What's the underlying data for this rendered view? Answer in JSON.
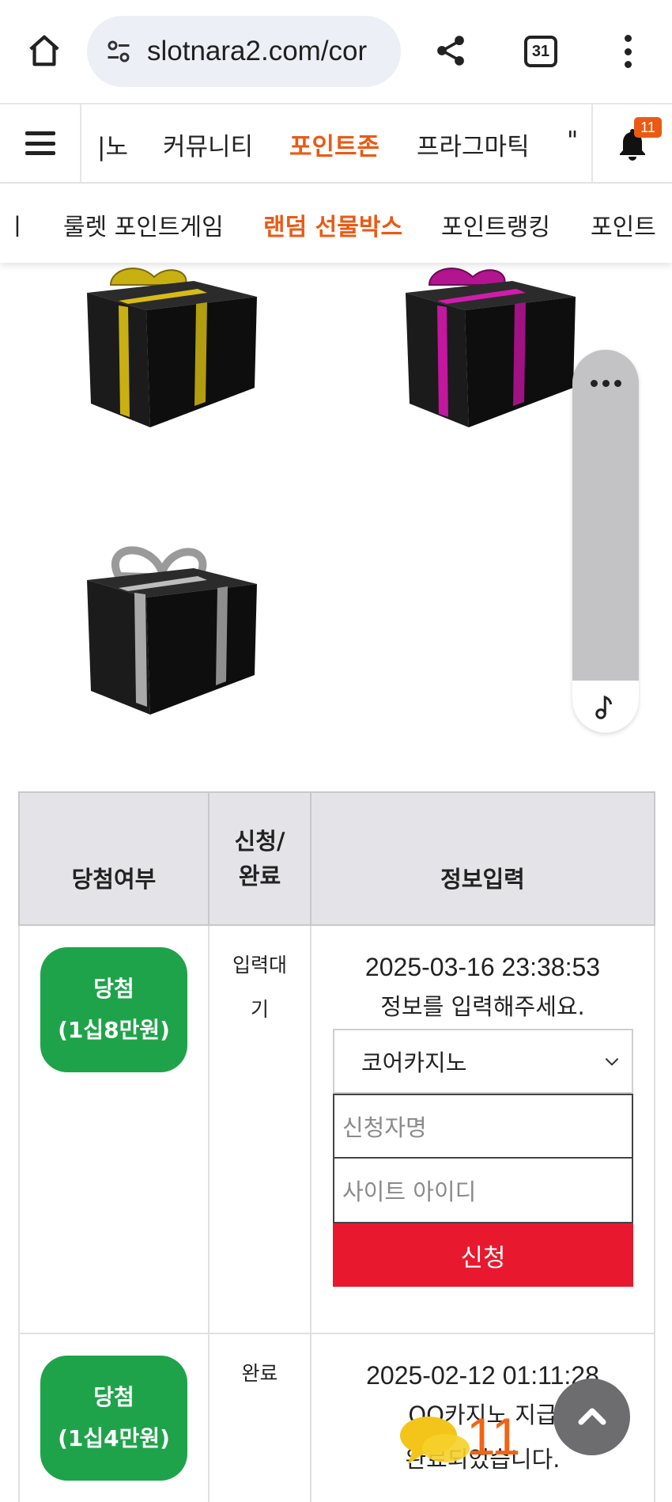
{
  "browser": {
    "url": "slotnara2.com/cor",
    "tab_count": "31",
    "icons": [
      "home-icon",
      "site-settings-icon",
      "share-icon",
      "tabs-icon",
      "more-vert-icon"
    ]
  },
  "main_nav": {
    "items": [
      "|노",
      "커뮤니티",
      "포인트존",
      "프라그마틱",
      "\""
    ],
    "active": "포인트존",
    "notification_count": "11"
  },
  "sub_nav": {
    "items": [
      "ㅣ",
      "룰렛 포인트게임",
      "랜덤 선물박스",
      "포인트랭킹",
      "포인트"
    ],
    "active": "랜덤 선물박스"
  },
  "gifts": [
    {
      "ribbon_color": "#c9b012"
    },
    {
      "ribbon_color": "#c2179e"
    },
    {
      "ribbon_color": "#a9a9a9"
    }
  ],
  "table": {
    "headers": {
      "result": "당첨여부",
      "apply_line1": "신청/",
      "apply_line2": "완료",
      "info": "정보입력"
    },
    "rows": [
      {
        "badge_line1": "당첨",
        "badge_line2": "(1십8만원)",
        "status_line1": "입력대",
        "status_line2": "기",
        "date": "2025-03-16 23:38:53",
        "message": "정보를 입력해주세요.",
        "select_value": "코어카지노",
        "name_placeholder": "신청자명",
        "id_placeholder": "사이트 아이디",
        "submit_label": "신청"
      },
      {
        "badge_line1": "당첨",
        "badge_line2": "(1십4만원)",
        "status_line1": "완료",
        "date": "2025-02-12 01:11:28",
        "message_line1": "OO카지노 지급",
        "message_line2": "완료되었습니다."
      }
    ]
  },
  "chat": {
    "count": "11"
  },
  "colors": {
    "accent_orange": "#ea5a14",
    "win_green": "#1fa34a",
    "submit_red": "#e8192e",
    "header_gray": "#e4e3e7"
  }
}
